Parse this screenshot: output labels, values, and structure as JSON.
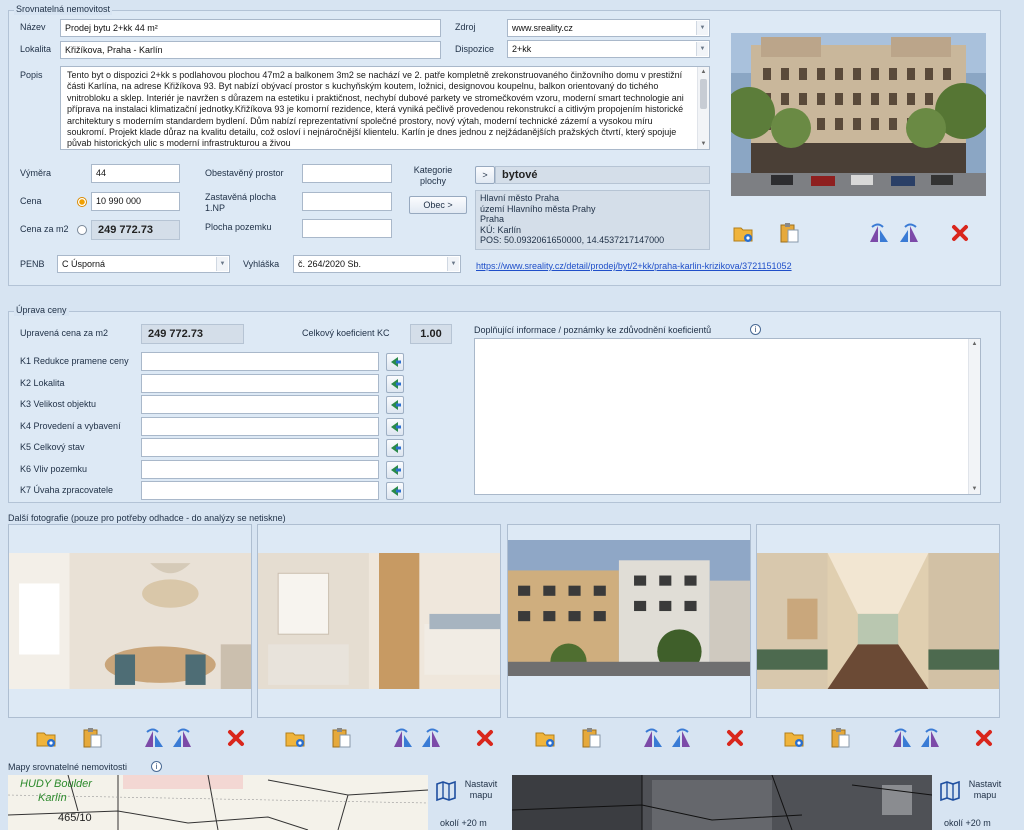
{
  "section_comparable": {
    "title": "Srovnatelná nemovitost",
    "labels": {
      "name": "Název",
      "locality": "Lokalita",
      "description": "Popis",
      "source": "Zdroj",
      "layout": "Dispozice",
      "area": "Výměra",
      "price": "Cena",
      "price_per_m2": "Cena za m2",
      "built_space": "Obestavěný prostor",
      "built_area": "Zastavěná plocha 1.NP",
      "land_area": "Plocha pozemku",
      "category": "Kategorie plochy",
      "penb": "PENB",
      "decree": "Vyhláška"
    },
    "name": "Prodej bytu 2+kk 44 m²",
    "locality": "Křižíkova, Praha - Karlín",
    "source": "www.sreality.cz",
    "layout": "2+kk",
    "description": "Tento byt o dispozici 2+kk s podlahovou plochou 47m2 a balkonem 3m2 se nachází ve 2. patře kompletně zrekonstruovaného činžovního domu v prestižní části Karlína, na adrese Křižíkova 93. Byt nabízí obývací prostor s kuchyňským koutem, ložnici, designovou koupelnu, balkon orientovaný do tichého vnitrobloku a sklep. Interiér je navržen s důrazem na estetiku i praktičnost, nechybí dubové parkety ve stromečkovém vzoru, moderní smart technologie ani příprava na instalaci klimatizační jednotky.Křižíkova 93 je komorní rezidence, která vyniká pečlivě provedenou rekonstrukcí a citlivým propojením historické architektury s moderním standardem bydlení. Dům nabízí reprezentativní společné prostory, nový výtah, moderní technické zázemí a vysokou míru soukromí. Projekt klade důraz na kvalitu detailu, což osloví i nejnáročnější klientelu.  Karlín je dnes jednou z nejžádanějších pražských čtvrtí, který spojuje půvab historických ulic s moderní infrastrukturou a živou",
    "area": "44",
    "price": "10 990 000",
    "price_per_m2": "249 772.73",
    "built_space": "",
    "built_area": "",
    "land_area": "",
    "category_btn": ">",
    "category_value": "bytové",
    "municipality_btn": "Obec >",
    "address": [
      "Hlavní město Praha",
      "území Hlavního města Prahy",
      "Praha",
      "KÚ: Karlín",
      "POS: 50.0932061650000, 14.4537217147000"
    ],
    "penb": "C Úsporná",
    "decree": "č. 264/2020 Sb.",
    "url": "https://www.sreality.cz/detail/prodej/byt/2+kk/praha-karlin-krizikova/3721151052"
  },
  "section_adjust": {
    "title": "Úprava ceny",
    "adjusted_label": "Upravená cena za m2",
    "adjusted_value": "249 772.73",
    "kc_label": "Celkový koeficient KC",
    "kc_value": "1.00",
    "notes_label": "Doplňující informace / poznámky ke zdůvodnění koeficientů",
    "notes_value": "",
    "coefficients": [
      {
        "label": "K1 Redukce pramene ceny",
        "value": ""
      },
      {
        "label": "K2 Lokalita",
        "value": ""
      },
      {
        "label": "K3 Velikost objektu",
        "value": ""
      },
      {
        "label": "K4 Provedení a vybavení",
        "value": ""
      },
      {
        "label": "K5 Celkový stav",
        "value": ""
      },
      {
        "label": "K6 Vliv pozemku",
        "value": ""
      },
      {
        "label": "K7 Úvaha zpracovatele",
        "value": ""
      }
    ]
  },
  "photos_label": "Další fotografie (pouze pro potřeby odhadce - do analýzy se netiskne)",
  "maps": {
    "label": "Mapy srovnatelné nemovitosti",
    "set_map_label": "Nastavit mapu",
    "surroundings": "okolí +20 m",
    "map_text_1": "HUDY Boulder",
    "map_text_2": "Karlín",
    "map_number": "465/10"
  },
  "colors": {
    "accent": "#1f4fc9",
    "delete": "#d9261c",
    "panel": "#dde9f5"
  }
}
